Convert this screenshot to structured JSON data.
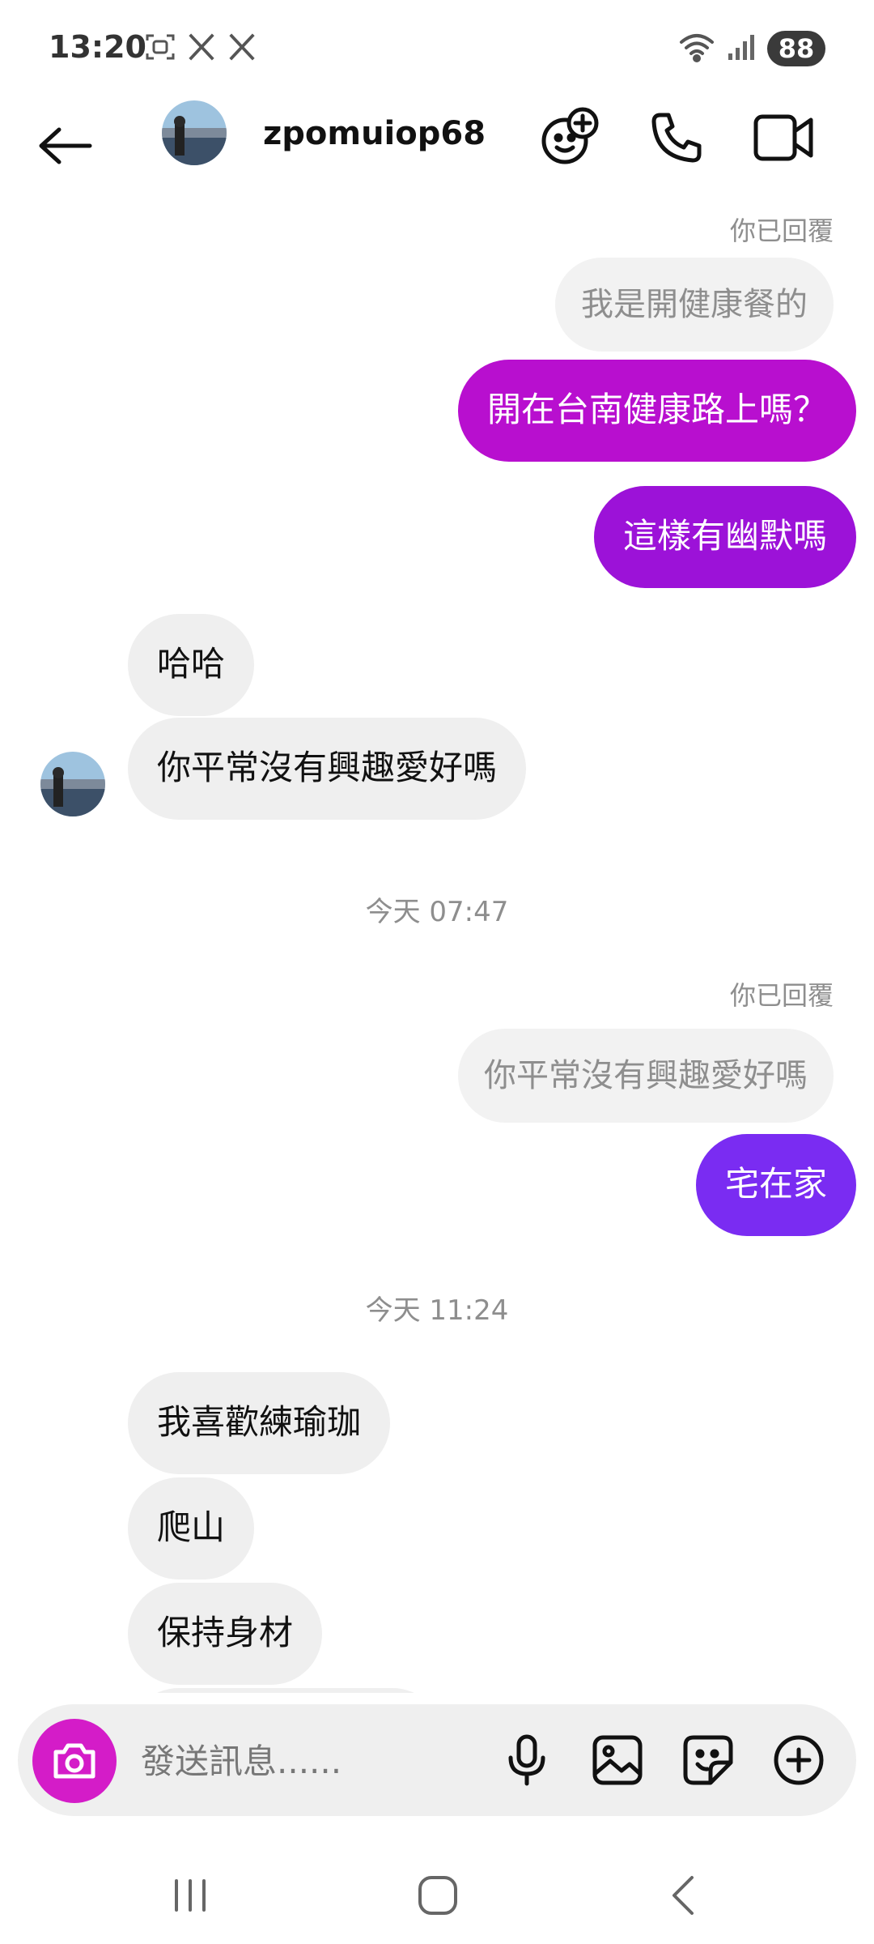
{
  "status_bar": {
    "time": "13:20",
    "battery": "88"
  },
  "header": {
    "username": "zpomuiop68"
  },
  "messages": {
    "replied_label_1": "你已回覆",
    "quoted_1": "我是開健康餐的",
    "sent_1": "開在台南健康路上嗎？",
    "sent_2": "這樣有幽默嗎",
    "recv_1": "哈哈",
    "recv_2": "你平常沒有興趣愛好嗎",
    "timestamp_1": "今天 07:47",
    "replied_label_2": "你已回覆",
    "quoted_2": "你平常沒有興趣愛好嗎",
    "sent_3": "宅在家",
    "timestamp_2": "今天 11:24",
    "recv_3": "我喜歡練瑜珈",
    "recv_4": "爬山",
    "recv_5": "保持身材"
  },
  "composer": {
    "placeholder": "發送訊息......"
  },
  "colors": {
    "sent_magenta": "#b80fcf",
    "sent_purple_mid": "#9c12d8",
    "sent_violet": "#7a2cf2",
    "camera_button": "#d41cc8",
    "received_bubble": "#efefef"
  },
  "icons": {
    "status_left": [
      "screenshot-icon",
      "x-logo-icon",
      "x-logo-icon"
    ],
    "status_right": [
      "wifi-icon",
      "signal-icon"
    ],
    "header": [
      "back-arrow-icon",
      "sticker-add-icon",
      "phone-icon",
      "video-camera-icon"
    ],
    "composer": [
      "camera-icon",
      "microphone-icon",
      "gallery-icon",
      "sticker-icon",
      "plus-circle-icon"
    ],
    "navbar": [
      "recent-apps-icon",
      "home-icon",
      "back-icon"
    ]
  }
}
